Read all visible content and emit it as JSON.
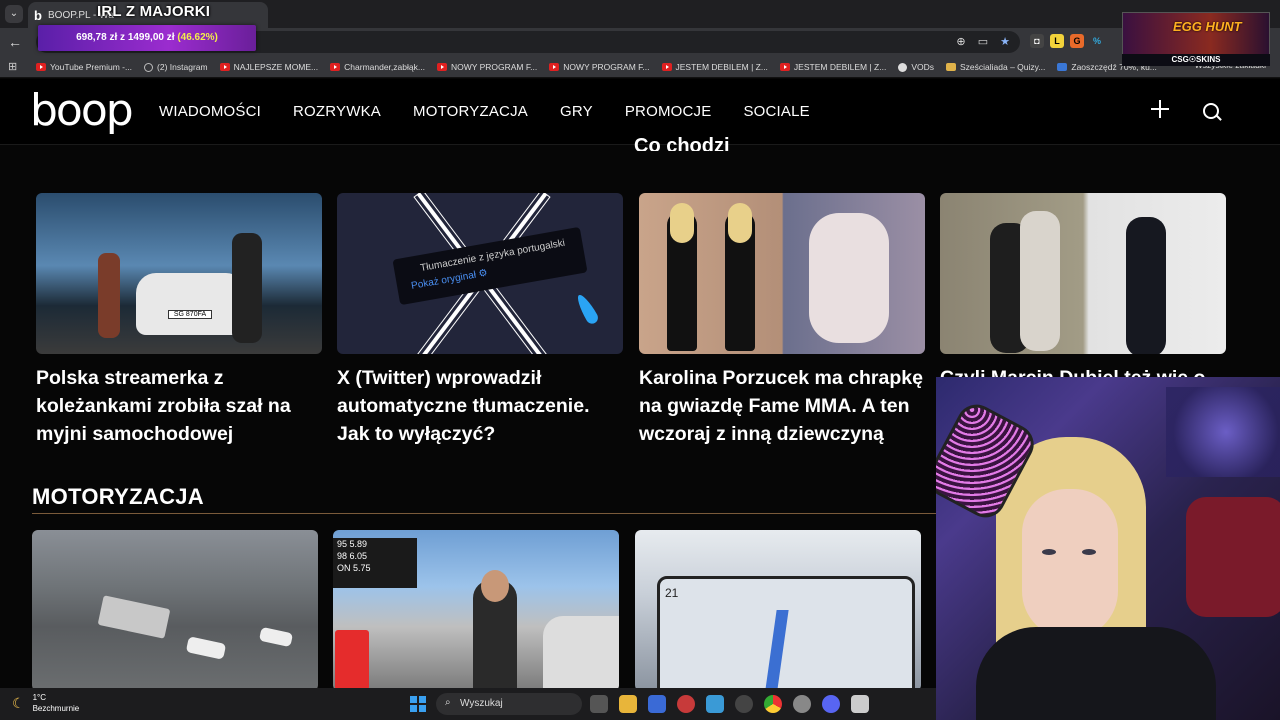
{
  "browser": {
    "tab_title": "BOOP.PL - Wa",
    "stream_title": "IRL Z MAJORKI",
    "bookmarks": [
      {
        "label": "YouTube Premium -...",
        "icon": "youtube-icon"
      },
      {
        "label": "(2) Instagram",
        "icon": "instagram-icon"
      },
      {
        "label": "NAJLEPSZE MOME...",
        "icon": "youtube-icon"
      },
      {
        "label": "Charmander,zabłąk...",
        "icon": "youtube-icon"
      },
      {
        "label": "NOWY PROGRAM F...",
        "icon": "youtube-icon"
      },
      {
        "label": "NOWY PROGRAM F...",
        "icon": "youtube-icon"
      },
      {
        "label": "JESTEM DEBILEM | Z...",
        "icon": "youtube-icon"
      },
      {
        "label": "JESTEM DEBILEM | Z...",
        "icon": "youtube-icon"
      },
      {
        "label": "VODs",
        "icon": "globe-icon"
      },
      {
        "label": "Sześcialiada – Quizy...",
        "icon": "quiz-icon"
      },
      {
        "label": "Zaoszczędź 70%, ku...",
        "icon": "steam-icon"
      }
    ],
    "bookmarks_all": "Wszystkie zakładki"
  },
  "donation_goal": {
    "current": "698,78 zł",
    "separator": "z",
    "target": "1499,00 zł",
    "percent": "(46.62%)",
    "progress": 0.4662
  },
  "overlay": {
    "event_title": "EGG HUNT",
    "sponsor": "CSG☉SKINS"
  },
  "site": {
    "logo": "boop",
    "nav": [
      "WIADOMOŚCI",
      "ROZRYWKA",
      "MOTORYZACJA",
      "GRY",
      "PROMOCJE",
      "SOCIALE"
    ],
    "section_peek": "Co chodzi",
    "cards_top": [
      {
        "title": "Polska streamerka z koleżankami zrobiła szał na myjni samochodowej",
        "plate": "SG 870FA"
      },
      {
        "title": "X (Twitter) wprowadził automatyczne tłumaczenie. Jak to wyłączyć?",
        "tip_line1": "Tłumaczenie z języka portugalski",
        "tip_line2": "Pokaż oryginał ⚙"
      },
      {
        "title": "Karolina Porzucek ma chrapkę na gwiazdę Fame MMA. A ten wczoraj z inną dziewczyną"
      },
      {
        "title": "Czyli Marcin Dubiel też wie o"
      }
    ],
    "section_title": "MOTORYZACJA",
    "fuel_prices": [
      "95 5.89",
      "98 6.05",
      "ON 5.75"
    ],
    "tesla_speed": "21"
  },
  "taskbar": {
    "temperature": "1°C",
    "weather": "Bezchmurnie",
    "search_label": "Wyszukaj"
  },
  "colors": {
    "accent_purple": "#9b2ccf",
    "percent_yellow": "#f2ef4a",
    "section_line": "#7a5a3a"
  }
}
